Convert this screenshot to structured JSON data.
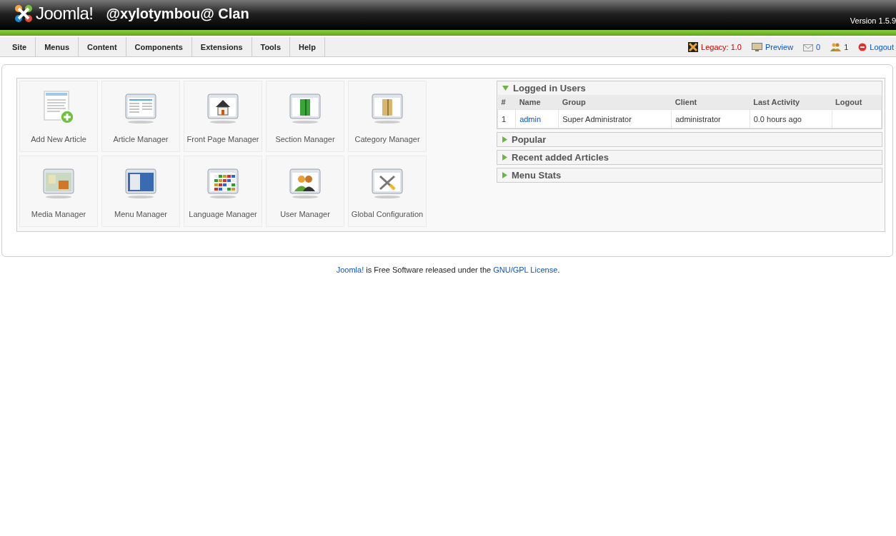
{
  "header": {
    "logo": "Joomla!",
    "site_name": "@xylotymbou@ Clan",
    "version": "Version 1.5.9"
  },
  "menu": [
    {
      "label": "Site"
    },
    {
      "label": "Menus"
    },
    {
      "label": "Content"
    },
    {
      "label": "Components"
    },
    {
      "label": "Extensions"
    },
    {
      "label": "Tools"
    },
    {
      "label": "Help"
    }
  ],
  "status": [
    {
      "kind": "legacy",
      "label": "Legacy: 1.0"
    },
    {
      "kind": "preview",
      "label": "Preview"
    },
    {
      "kind": "messages",
      "label": "0"
    },
    {
      "kind": "users",
      "label": "1"
    },
    {
      "kind": "logout",
      "label": "Logout"
    }
  ],
  "quickicons": [
    {
      "label": "Add New Article"
    },
    {
      "label": "Article Manager"
    },
    {
      "label": "Front Page Manager"
    },
    {
      "label": "Section Manager"
    },
    {
      "label": "Category Manager"
    },
    {
      "label": "Media Manager"
    },
    {
      "label": "Menu Manager"
    },
    {
      "label": "Language Manager"
    },
    {
      "label": "User Manager"
    },
    {
      "label": "Global Configuration"
    }
  ],
  "panels": [
    {
      "title": "Logged in Users",
      "expanded": true,
      "table": {
        "columns": [
          "#",
          "Name",
          "Group",
          "Client",
          "Last Activity",
          "Logout"
        ],
        "rows": [
          [
            "1",
            "admin",
            "Super Administrator",
            "administrator",
            "0.0 hours ago",
            ""
          ]
        ]
      }
    },
    {
      "title": "Popular",
      "expanded": false
    },
    {
      "title": "Recent added Articles",
      "expanded": false
    },
    {
      "title": "Menu Stats",
      "expanded": false
    }
  ],
  "footer": {
    "link1": "Joomla!",
    "text": "is Free Software released under the",
    "link2": "GNU/GPL License",
    "end": "."
  }
}
